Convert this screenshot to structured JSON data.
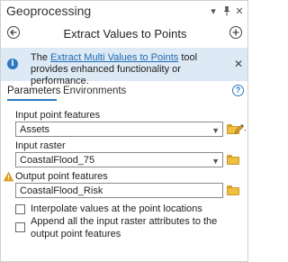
{
  "pane": {
    "title": "Geoprocessing",
    "controls": {
      "options": "▾",
      "pin": "⊥",
      "close": "✕"
    }
  },
  "tool": {
    "title": "Extract Values to Points",
    "back_icon": "back-arrow-icon",
    "add_icon": "add-icon"
  },
  "info": {
    "prefix": "The ",
    "link": "Extract Multi Values to Points",
    "suffix": " tool provides enhanced functionality or performance.",
    "close": "✕"
  },
  "tabs": [
    {
      "label": "Parameters",
      "active": true
    },
    {
      "label": "Environments",
      "active": false
    }
  ],
  "help": "?",
  "fields": {
    "input_points": {
      "label": "Input point features",
      "value": "Assets"
    },
    "input_raster": {
      "label": "Input raster",
      "value": "CoastalFlood_75"
    },
    "output_points": {
      "label": "Output point features",
      "value": "CoastalFlood_Risk"
    }
  },
  "checkboxes": [
    {
      "label": "Interpolate values at the point locations",
      "checked": false
    },
    {
      "label": "Append all the input raster attributes to the output point features",
      "checked": false
    }
  ],
  "colors": {
    "accent": "#2b77c1",
    "banner": "#dde9f5",
    "warning": "#e8a317",
    "folder": "#f0bf3f"
  }
}
